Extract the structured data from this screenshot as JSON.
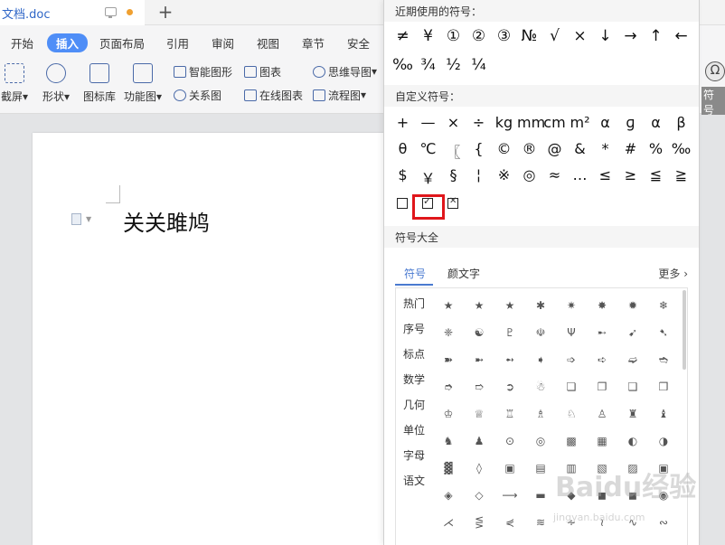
{
  "titlebar": {
    "doc_title": "文档.doc"
  },
  "ribbon": {
    "tabs": [
      "开始",
      "插入",
      "页面布局",
      "引用",
      "审阅",
      "视图",
      "章节",
      "安全"
    ],
    "active_tab": "插入",
    "tools": {
      "screenshot": "截屏",
      "shapes": "形状",
      "icon_library": "图标库",
      "function_chart": "功能图",
      "smart_shape": "智能图形",
      "relation_chart": "关系图",
      "chart": "图表",
      "online_chart": "在线图表",
      "mind_map": "思维导图",
      "flowchart": "流程图"
    },
    "right_button": "符号"
  },
  "document": {
    "text": "关关雎鸠"
  },
  "symbol_panel": {
    "recent_title": "近期使用的符号：",
    "recent_symbols": [
      "≠",
      "¥",
      "①",
      "②",
      "③",
      "№",
      "√",
      "×",
      "↓",
      "→",
      "↑",
      "←",
      "‰",
      "¾",
      "½",
      "¼"
    ],
    "custom_title": "自定义符号：",
    "custom_symbols": [
      [
        "+",
        "—",
        "×",
        "÷",
        "kg",
        "mm",
        "cm",
        "m²",
        "α",
        "ɡ",
        "α",
        "β"
      ],
      [
        "θ",
        "℃",
        "〖",
        "{",
        "©",
        "®",
        "@",
        "&",
        "*",
        "#",
        "%",
        "‰"
      ],
      [
        "$",
        "￥",
        "§",
        "¦",
        "※",
        "◎",
        "≈",
        "…",
        "≤",
        "≥",
        "≦",
        "≧"
      ],
      [
        "☐",
        "☑",
        "☒"
      ]
    ],
    "all_title": "符号大全",
    "subtabs": [
      "符号",
      "颜文字"
    ],
    "more": "更多",
    "categories": [
      "热门",
      "序号",
      "标点",
      "数学",
      "几何",
      "单位",
      "字母",
      "语文"
    ],
    "grid": [
      [
        "★",
        "★",
        "★",
        "✱",
        "✷",
        "✸",
        "✹",
        "❄"
      ],
      [
        "❈",
        "☯",
        "♇",
        "☫",
        "Ψ",
        "➸",
        "➹",
        "➷"
      ],
      [
        "➽",
        "➼",
        "➻",
        "➧",
        "➩",
        "➪",
        "➫",
        "➬"
      ],
      [
        "➮",
        "➱",
        "➲",
        "☃",
        "❏",
        "❐",
        "❑",
        "❒"
      ],
      [
        "♔",
        "♕",
        "♖",
        "♗",
        "♘",
        "♙",
        "♜",
        "♝"
      ],
      [
        "♞",
        "♟",
        "⊙",
        "◎",
        "▩",
        "▦",
        "◐",
        "◑"
      ],
      [
        "▓",
        "◊",
        "▣",
        "▤",
        "▥",
        "▧",
        "▨",
        "▣"
      ],
      [
        "◈",
        "◇",
        "⟶",
        "▬",
        "◆",
        "◼",
        "◼",
        "◉"
      ],
      [
        "⋌",
        "⋚",
        "⋞",
        "≋",
        "∻",
        "≀",
        "∿",
        "∾"
      ]
    ]
  },
  "watermark": {
    "main": "Baidu经验",
    "sub": "jingyan.baidu.com"
  }
}
